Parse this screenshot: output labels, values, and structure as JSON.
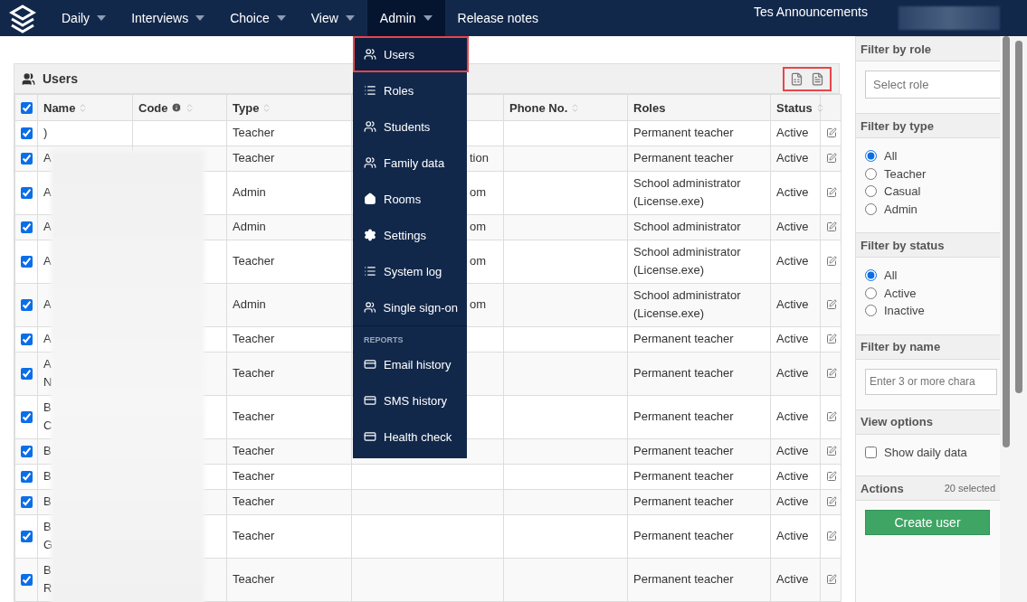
{
  "nav": {
    "items": [
      {
        "label": "Daily",
        "dropdown": true,
        "selected": false
      },
      {
        "label": "Interviews",
        "dropdown": true,
        "selected": false
      },
      {
        "label": "Choice",
        "dropdown": true,
        "selected": false
      },
      {
        "label": "View",
        "dropdown": true,
        "selected": false
      },
      {
        "label": "Admin",
        "dropdown": true,
        "selected": true
      },
      {
        "label": "Release notes",
        "dropdown": false,
        "selected": false
      }
    ],
    "announcements": "Tes Announcements"
  },
  "admin_menu": [
    {
      "kind": "item",
      "label": "Users",
      "highlighted": true
    },
    {
      "kind": "item",
      "label": "Roles",
      "highlighted": false
    },
    {
      "kind": "item",
      "label": "Students",
      "highlighted": false
    },
    {
      "kind": "item",
      "label": "Family data",
      "highlighted": false
    },
    {
      "kind": "item",
      "label": "Rooms",
      "highlighted": false
    },
    {
      "kind": "item",
      "label": "Settings",
      "highlighted": false
    },
    {
      "kind": "item",
      "label": "System log",
      "highlighted": false
    },
    {
      "kind": "item",
      "label": "Single sign-on",
      "highlighted": false
    },
    {
      "kind": "section",
      "label": "REPORTS"
    },
    {
      "kind": "item",
      "label": "Email history",
      "highlighted": false
    },
    {
      "kind": "item",
      "label": "SMS history",
      "highlighted": false
    },
    {
      "kind": "item",
      "label": "Health check",
      "highlighted": false
    }
  ],
  "users_panel": {
    "title": "Users",
    "export_highlighted": true,
    "select_all": true,
    "columns": [
      {
        "label": "Name",
        "sortable": true,
        "info": false
      },
      {
        "label": "Code",
        "sortable": true,
        "info": true
      },
      {
        "label": "Type",
        "sortable": true,
        "info": false
      },
      {
        "sortable": false,
        "info": false
      },
      {
        "label": "Phone No.",
        "sortable": true,
        "info": false
      },
      {
        "label": "Roles",
        "sortable": false,
        "info": false
      },
      {
        "label": "Status",
        "sortable": true,
        "info": false
      }
    ],
    "rows": [
      {
        "checked": true,
        "name": ")",
        "type": "Teacher",
        "column_4": "",
        "roles": "Permanent teacher",
        "status": "Active"
      },
      {
        "checked": true,
        "name": "A",
        "type": "Teacher",
        "column_4": "tion",
        "roles": "Permanent teacher",
        "status": "Active"
      },
      {
        "checked": true,
        "name": "A",
        "type": "Admin",
        "column_4": "om",
        "roles": "School administrator\n(License.exe)",
        "status": "Active"
      },
      {
        "checked": true,
        "name": "A",
        "type": "Admin",
        "column_4": "om",
        "roles": "School administrator",
        "status": "Active"
      },
      {
        "checked": true,
        "name": "A",
        "type": "Teacher",
        "column_4": "om",
        "roles": "School administrator\n(License.exe)",
        "status": "Active"
      },
      {
        "checked": true,
        "name": "A",
        "type": "Admin",
        "column_4": "om",
        "roles": "School administrator\n(License.exe)",
        "status": "Active"
      },
      {
        "checked": true,
        "name": "A",
        "type": "Teacher",
        "column_4": "",
        "roles": "Permanent teacher",
        "status": "Active"
      },
      {
        "checked": true,
        "name": "A\nN",
        "type": "Teacher",
        "column_4": "",
        "roles": "Permanent teacher",
        "status": "Active"
      },
      {
        "checked": true,
        "name": "B\nC",
        "type": "Teacher",
        "column_4": "",
        "roles": "Permanent teacher",
        "status": "Active"
      },
      {
        "checked": true,
        "name": "B",
        "type": "Teacher",
        "column_4": "",
        "roles": "Permanent teacher",
        "status": "Active"
      },
      {
        "checked": true,
        "name": "B",
        "type": "Teacher",
        "column_4": "",
        "roles": "Permanent teacher",
        "status": "Active"
      },
      {
        "checked": true,
        "name": "B",
        "type": "Teacher",
        "column_4": "",
        "roles": "Permanent teacher",
        "status": "Active"
      },
      {
        "checked": true,
        "name": "B\nG",
        "type": "Teacher",
        "column_4": "",
        "roles": "Permanent teacher",
        "status": "Active"
      },
      {
        "checked": true,
        "name": "B\nR",
        "type": "Teacher",
        "column_4": "",
        "roles": "Permanent teacher",
        "status": "Active"
      }
    ]
  },
  "sidebar": {
    "sections": [
      {
        "kind": "select",
        "title": "Filter by role",
        "placeholder": "Select role"
      },
      {
        "kind": "radios",
        "title": "Filter by type",
        "options": [
          {
            "label": "All",
            "selected": true
          },
          {
            "label": "Teacher",
            "selected": false
          },
          {
            "label": "Casual",
            "selected": false
          },
          {
            "label": "Admin",
            "selected": false
          }
        ]
      },
      {
        "kind": "radios",
        "title": "Filter by status",
        "options": [
          {
            "label": "All",
            "selected": true
          },
          {
            "label": "Active",
            "selected": false
          },
          {
            "label": "Inactive",
            "selected": false
          }
        ]
      },
      {
        "kind": "input",
        "title": "Filter by name",
        "placeholder": "Enter 3 or more chara"
      },
      {
        "kind": "checkbox",
        "title": "View options",
        "label": "Show daily data",
        "checked": false
      },
      {
        "kind": "actions",
        "title": "Actions",
        "count": "20 selected",
        "button": "Create user"
      }
    ]
  }
}
